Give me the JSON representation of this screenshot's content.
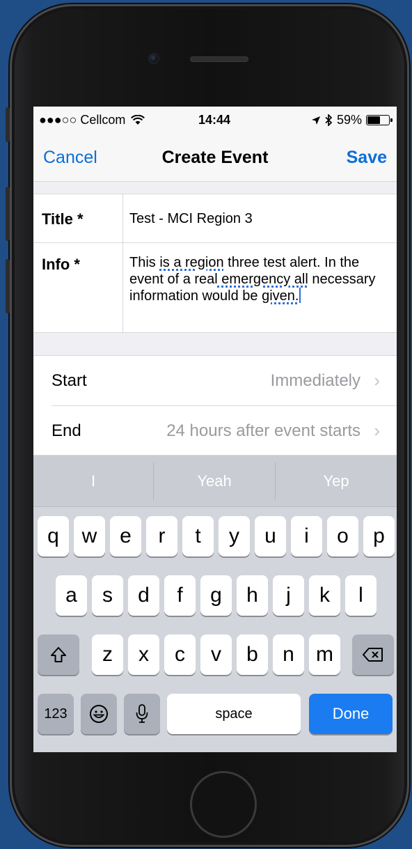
{
  "status_bar": {
    "carrier": "●●●○○ Cellcom",
    "time": "14:44",
    "battery": "59%",
    "battery_level": 0.59
  },
  "nav": {
    "cancel_label": "Cancel",
    "title": "Create Event",
    "save_label": "Save"
  },
  "form": {
    "title_label": "Title *",
    "title_value": "Test - MCI Region 3",
    "info_label": "Info *",
    "info_value": {
      "p1": "This ",
      "s1": "is a region",
      "p2": " three test alert. In the event of a real",
      "s2": " emergency all",
      "p3": " necessary information would be ",
      "s3": "given."
    }
  },
  "schedule": {
    "start_label": "Start",
    "start_value": "Immediately",
    "end_label": "End",
    "end_value": "24 hours after event starts"
  },
  "keyboard": {
    "suggestions": [
      "I",
      "Yeah",
      "Yep"
    ],
    "row1": [
      "q",
      "w",
      "e",
      "r",
      "t",
      "y",
      "u",
      "i",
      "o",
      "p"
    ],
    "row2": [
      "a",
      "s",
      "d",
      "f",
      "g",
      "h",
      "j",
      "k",
      "l"
    ],
    "row3": [
      "z",
      "x",
      "c",
      "v",
      "b",
      "n",
      "m"
    ],
    "numbers_label": "123",
    "space_label": "space",
    "done_label": "Done",
    "shift_icon": "shift-icon",
    "delete_icon": "delete-icon",
    "emoji_icon": "emoji-icon",
    "mic_icon": "microphone-icon"
  },
  "colors": {
    "accent": "#0a6fd8",
    "done_key": "#1a7cf0",
    "background": "#1f4d86"
  }
}
